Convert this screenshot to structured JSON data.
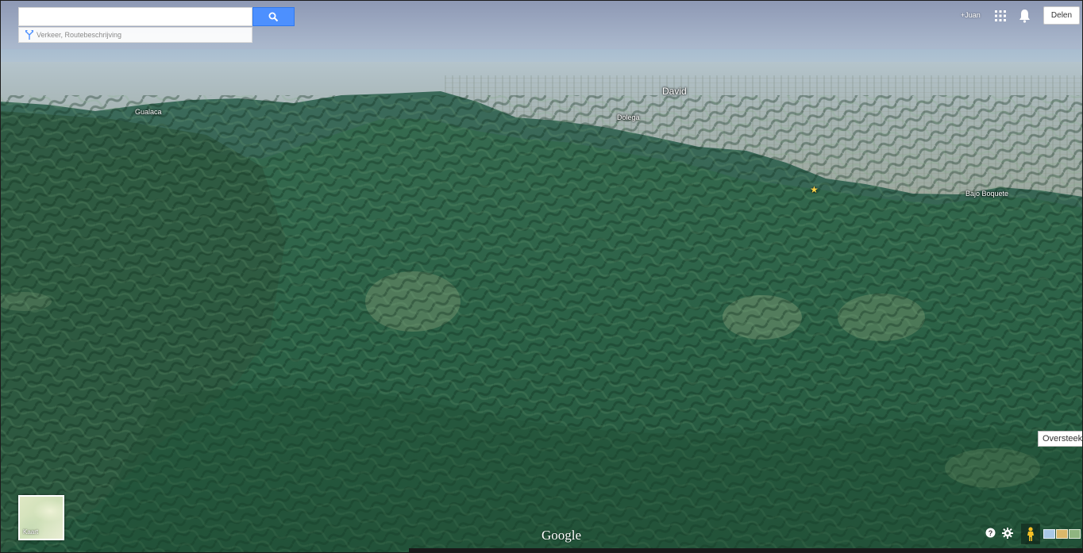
{
  "search": {
    "placeholder": "",
    "value": "",
    "suggestion": "Verkeer, Routebeschrijving",
    "search_icon": "search-icon",
    "route_icon": "route-icon"
  },
  "header": {
    "user": "+Juan",
    "share_label": "Delen",
    "apps_icon": "apps-grid-icon",
    "bell_icon": "bell-icon"
  },
  "map": {
    "places": [
      {
        "name": "David",
        "size": "big"
      },
      {
        "name": "Gualaca",
        "size": "small"
      },
      {
        "name": "Dolega",
        "size": "small"
      },
      {
        "name": "Bajo Boquete",
        "size": "small"
      }
    ],
    "marker_icon": "star-icon",
    "view_mode": "3D satellite"
  },
  "footer": {
    "map_toggle_label": "Kaart",
    "logo": "Google",
    "help_icon": "help-icon",
    "settings_icon": "gear-icon",
    "pegman_icon": "pegman-icon",
    "tooltip": "Oversteek",
    "accent": "#4d90fe"
  }
}
